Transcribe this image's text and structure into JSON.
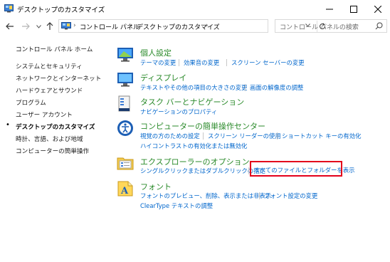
{
  "window": {
    "title": "デスクトップのカスタマイズ"
  },
  "addressbar": {
    "crumbs": [
      "コントロール パネル",
      "デスクトップのカスタマイズ"
    ],
    "search_placeholder": "コントロール パネルの検索"
  },
  "sidebar": {
    "items": [
      "コントロール パネル ホーム",
      "システムとセキュリティ",
      "ネットワークとインターネット",
      "ハードウェアとサウンド",
      "プログラム",
      "ユーザー アカウント",
      "デスクトップのカスタマイズ",
      "時計、言語、および地域",
      "コンピューターの簡単操作"
    ],
    "current_bullet": "•"
  },
  "categories": [
    {
      "title": "個人設定",
      "links": [
        "テーマの変更",
        "効果音の変更",
        "スクリーン セーバーの変更"
      ]
    },
    {
      "title": "ディスプレイ",
      "links": [
        "テキストやその他の項目の大きさの変更",
        "画面の解像度の調整"
      ]
    },
    {
      "title": "タスク バーとナビゲーション",
      "links": [
        "ナビゲーションのプロパティ"
      ]
    },
    {
      "title": "コンピューターの簡単操作センター",
      "links": [
        "視覚の方のための設定",
        "スクリーン リーダーの使用",
        "ショートカット キーの有効化",
        "ハイコントラストの有効化または無効化"
      ]
    },
    {
      "title": "エクスプローラーのオプション",
      "links": [
        "シングルクリックまたはダブルクリックの指定",
        "すべてのファイルとフォルダーを表示"
      ]
    },
    {
      "title": "フォント",
      "links": [
        "フォントのプレビュー、削除、表示または非表示",
        "フォント設定の変更",
        "ClearType テキストの調整"
      ]
    }
  ],
  "colors": {
    "category_title": "#2a8a2a",
    "link": "#0066cc",
    "highlight_border": "#e3001b"
  }
}
